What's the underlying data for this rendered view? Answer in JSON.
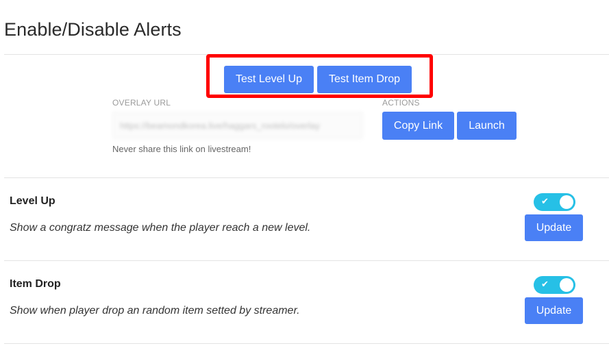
{
  "page": {
    "title": "Enable/Disable Alerts"
  },
  "test_buttons": {
    "level_up": "Test Level Up",
    "item_drop": "Test Item Drop"
  },
  "overlay": {
    "label": "OVERLAY URL",
    "url_value": "https://beamondkorea.live/haggars_rootelo/overlay",
    "hint": "Never share this link on livestream!"
  },
  "actions": {
    "label": "ACTIONS",
    "copy_link": "Copy Link",
    "launch": "Launch"
  },
  "alerts": [
    {
      "title": "Level Up",
      "description": "Show a congratz message when the player reach a new level.",
      "enabled": true,
      "update_label": "Update"
    },
    {
      "title": "Item Drop",
      "description": "Show when player drop an random item setted by streamer.",
      "enabled": true,
      "update_label": "Update"
    }
  ],
  "colors": {
    "primary_button": "#4a80f5",
    "toggle_on": "#26c0e6",
    "highlight": "#ff0000"
  },
  "icons": {
    "toggle_check": "check-icon"
  }
}
